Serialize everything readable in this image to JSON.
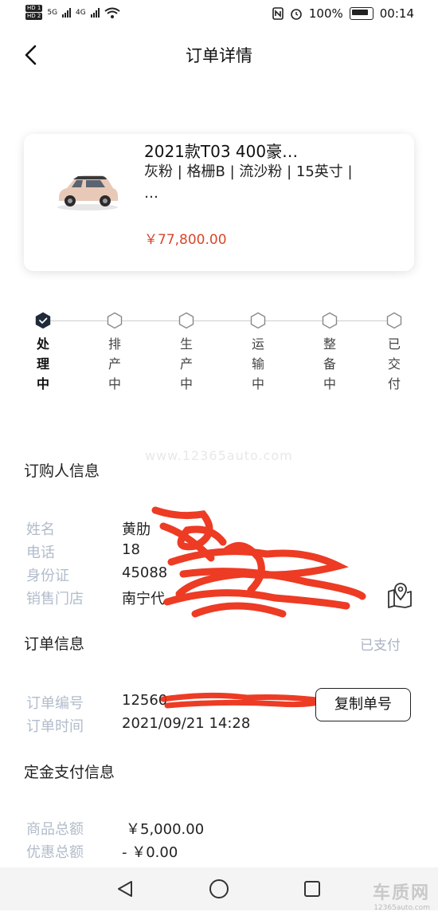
{
  "status_bar": {
    "sim1": "HD 1",
    "sim2": "HD 2",
    "net1": "5G",
    "net2": "4G",
    "battery": "100%",
    "time": "00:14"
  },
  "header": {
    "title": "订单详情"
  },
  "product": {
    "name": "2021款T03 400豪…",
    "spec": "灰粉 | 格栅B | 流沙粉 | 15英寸 | …",
    "price": "￥77,800.00"
  },
  "progress": {
    "steps": [
      {
        "label": "处理中",
        "state": "done"
      },
      {
        "label": "排产中",
        "state": "pending"
      },
      {
        "label": "生产中",
        "state": "pending"
      },
      {
        "label": "运输中",
        "state": "pending"
      },
      {
        "label": "整备中",
        "state": "pending"
      },
      {
        "label": "已交付",
        "state": "pending"
      }
    ]
  },
  "watermark": "www.12365auto.com",
  "buyer": {
    "title": "订购人信息",
    "name_label": "姓名",
    "name_value": "黄肋",
    "phone_label": "电话",
    "phone_value": "18",
    "id_label": "身份证",
    "id_value": "45088",
    "store_label": "销售门店",
    "store_value": "南宁代"
  },
  "order": {
    "title": "订单信息",
    "status": "已支付",
    "number_label": "订单编号",
    "number_value": "12560",
    "time_label": "订单时间",
    "time_value": "2021/09/21 14:28",
    "copy_button": "复制单号"
  },
  "deposit": {
    "title": "定金支付信息",
    "total_label": "商品总额",
    "total_value": "￥5,000.00",
    "discount_label": "优惠总额",
    "discount_value": "- ￥0.00"
  },
  "brand_watermark": {
    "name": "车质网",
    "url": "12365auto.com"
  }
}
